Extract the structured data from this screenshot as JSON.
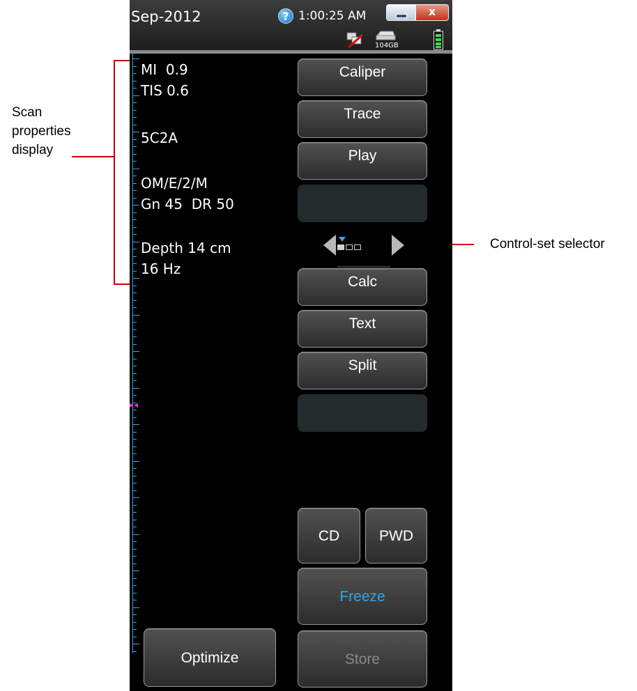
{
  "annotations": {
    "scan_properties": [
      "Scan",
      "properties",
      "display"
    ],
    "control_set_selector": "Control-set selector"
  },
  "titlebar": {
    "date": "Sep-2012",
    "time": "1:00:25 AM",
    "help_glyph": "?",
    "close_glyph": "x",
    "storage": "104GB",
    "icons": [
      "help-icon",
      "network-disconnected-icon",
      "storage-drive-icon",
      "battery-icon"
    ]
  },
  "scan_properties": {
    "mi": "MI  0.9",
    "tis": "TIS 0.6",
    "transducer": "5C2A",
    "mode": "OM/E/2/M",
    "gain_dr": "Gn 45  DR 50",
    "depth": "Depth 14 cm",
    "frame_rate": "16 Hz"
  },
  "controls": {
    "set1": [
      "Caliper",
      "Trace",
      "Play"
    ],
    "set2": [
      "Calc",
      "Text",
      "Split"
    ],
    "cd": "CD",
    "pwd": "PWD",
    "freeze": "Freeze",
    "optimize": "Optimize",
    "store": "Store"
  },
  "colors": {
    "accent_blue": "#2ea7e8",
    "depth_scale": "#3aa4df",
    "focus_marker": "#ff2de0",
    "annotation_line": "#cc0000"
  }
}
